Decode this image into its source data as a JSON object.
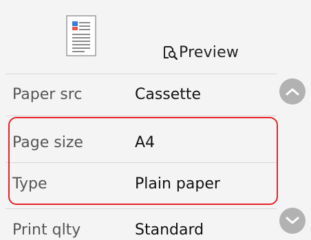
{
  "header": {
    "document_icon": "document-thumbnail-icon",
    "preview_icon": "preview-magnifier-icon",
    "preview_label": "Preview"
  },
  "settings": [
    {
      "key": "Paper src",
      "value": "Cassette"
    },
    {
      "key": "Page size",
      "value": "A4"
    },
    {
      "key": "Type",
      "value": "Plain paper"
    },
    {
      "key": "Print qlty",
      "value": "Standard"
    }
  ],
  "scroll": {
    "up_icon": "chevron-up-icon",
    "down_icon": "chevron-down-icon"
  },
  "colors": {
    "highlight": "#e8202a",
    "scroll_button": "#b2b2b2",
    "background": "#f4f4f4"
  }
}
